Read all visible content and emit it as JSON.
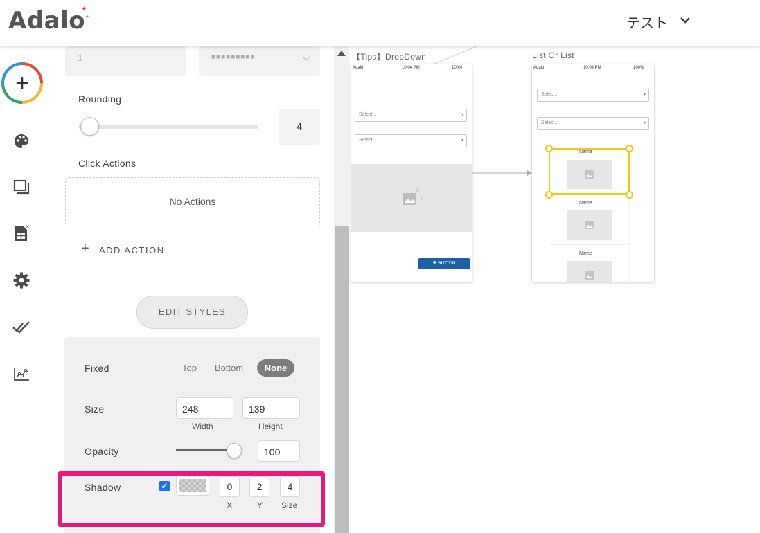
{
  "header": {
    "logo": "Adalo",
    "app_name": "テスト"
  },
  "rail": {
    "icons": [
      "add-icon",
      "palette-icon",
      "screens-icon",
      "database-icon",
      "gear-icon",
      "publish-checks-icon",
      "analytics-icon"
    ]
  },
  "panel": {
    "top_input_value": "1",
    "top_select_value": "■■■■■■■■■",
    "rounding": {
      "label": "Rounding",
      "value": "4",
      "slider_fraction": 0.05
    },
    "click_actions": {
      "label": "Click Actions",
      "empty_text": "No Actions",
      "add_label": "ADD ACTION"
    },
    "edit_styles_label": "EDIT STYLES",
    "fixed": {
      "label": "Fixed",
      "options": [
        "Top",
        "Bottom",
        "None"
      ],
      "selected": "None"
    },
    "size": {
      "label": "Size",
      "width": "248",
      "height": "139",
      "width_label": "Width",
      "height_label": "Height"
    },
    "opacity": {
      "label": "Opacity",
      "value": "100",
      "slider_fraction": 1.0
    },
    "shadow": {
      "label": "Shadow",
      "checked": true,
      "x": "0",
      "y": "2",
      "size": "4",
      "x_label": "X",
      "y_label": "Y",
      "size_label": "Size"
    }
  },
  "canvas": {
    "screen1": {
      "title": "【Tips】DropDown",
      "status_left": "Adalo",
      "status_time": "10:04 PM",
      "status_battery": "100%",
      "select1": "Select...",
      "select2": "Select...",
      "button_label": "BUTTON"
    },
    "screen2": {
      "title": "List Or List",
      "status_left": "Adalo",
      "status_time": "10:04 PM",
      "status_battery": "100%",
      "select1": "Select...",
      "select2": "Select...",
      "list_items": [
        "Name",
        "Name",
        "Name"
      ]
    }
  },
  "colors": {
    "accent_blue": "#1e5fa8",
    "selection_yellow": "#f5c518",
    "highlight_pink": "#e8197c",
    "toggle_selected": "#7d7d7d"
  }
}
